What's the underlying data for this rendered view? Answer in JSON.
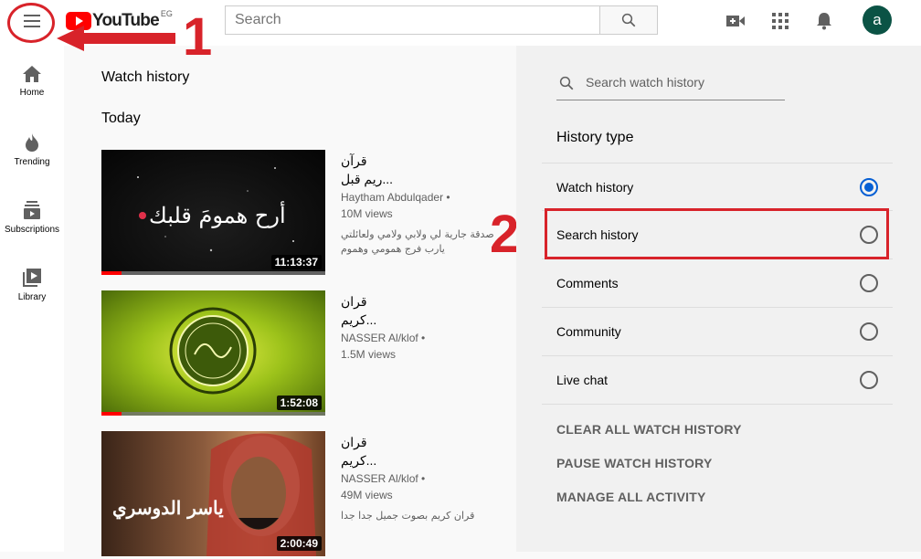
{
  "header": {
    "logo_text": "YouTube",
    "country": "EG",
    "search_placeholder": "Search",
    "avatar_letter": "a"
  },
  "annotations": {
    "num1": "1",
    "num2": "2"
  },
  "sidebar": {
    "items": [
      {
        "label": "Home"
      },
      {
        "label": "Trending"
      },
      {
        "label": "Subscriptions"
      },
      {
        "label": "Library"
      }
    ]
  },
  "main": {
    "page_title": "Watch history",
    "day_label": "Today",
    "videos": [
      {
        "title_line1": "قرآن",
        "title_line2": "ريم قبل...",
        "channel": "Haytham Abdulqader •",
        "views": "10M views",
        "description": "صدقة جارية لي ولابي ولامي ولعائلتي يارب فرج همومي وهموم",
        "duration": "11:13:37",
        "thumb_text": "أرح همومَ قلبك",
        "watched": 0.09
      },
      {
        "title_line1": "قران",
        "title_line2": "كريم...",
        "channel": "NASSER Al/klof •",
        "views": "1.5M views",
        "description": "",
        "duration": "1:52:08",
        "thumb_text": "",
        "watched": 0.09
      },
      {
        "title_line1": "قران",
        "title_line2": "كريم...",
        "channel": "NASSER Al/klof •",
        "views": "49M views",
        "description": "قران كريم بصوت جميل جدا جدا",
        "duration": "2:00:49",
        "thumb_text": "ياسر الدوسري",
        "watched": 0.0
      }
    ]
  },
  "history_panel": {
    "search_placeholder": "Search watch history",
    "type_heading": "History type",
    "types": [
      {
        "label": "Watch history",
        "selected": true
      },
      {
        "label": "Search history",
        "selected": false
      },
      {
        "label": "Comments",
        "selected": false
      },
      {
        "label": "Community",
        "selected": false
      },
      {
        "label": "Live chat",
        "selected": false
      }
    ],
    "actions": {
      "clear": "CLEAR ALL WATCH HISTORY",
      "pause": "PAUSE WATCH HISTORY",
      "manage": "MANAGE ALL ACTIVITY"
    }
  },
  "colors": {
    "annotation_red": "#d8232a",
    "brand_red": "#ff0000",
    "radio_blue": "#065fd4"
  }
}
